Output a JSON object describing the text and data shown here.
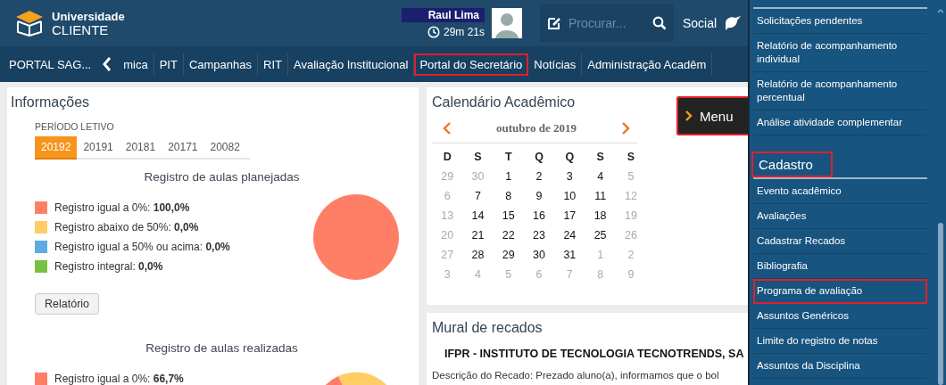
{
  "header": {
    "logo_line1": "Universidade",
    "logo_line2": "CLIENTE",
    "user_name": "Raul Lima",
    "session_timer": "29m 21s",
    "search": {
      "placeholder": "Procurar..."
    },
    "social": "Social"
  },
  "nav": {
    "home": "PORTAL SAG...",
    "items": [
      {
        "label": "mica",
        "highlighted": false
      },
      {
        "label": "PIT",
        "highlighted": false
      },
      {
        "label": "Campanhas",
        "highlighted": false
      },
      {
        "label": "RIT",
        "highlighted": false
      },
      {
        "label": "Avaliação Institucional",
        "highlighted": false
      },
      {
        "label": "Portal do Secretário",
        "highlighted": true
      },
      {
        "label": "Notícias",
        "highlighted": false
      },
      {
        "label": "Administração Acadêm",
        "highlighted": false
      }
    ]
  },
  "info": {
    "title": "Informações",
    "period_label": "PERÍODO LETIVO",
    "periods": [
      {
        "label": "20192",
        "selected": true
      },
      {
        "label": "20191",
        "selected": false
      },
      {
        "label": "20181",
        "selected": false
      },
      {
        "label": "20171",
        "selected": false
      },
      {
        "label": "20082",
        "selected": false
      }
    ],
    "planned": {
      "title": "Registro de aulas planejadas",
      "legend": [
        {
          "label": "Registro igual a 0%:",
          "value": "100,0%",
          "color": "#ff7f66"
        },
        {
          "label": "Registro abaixo de 50%:",
          "value": "0,0%",
          "color": "#ffcc66"
        },
        {
          "label": "Registro igual a 50% ou acima:",
          "value": "0,0%",
          "color": "#5dade2"
        },
        {
          "label": "Registro integral:",
          "value": "0,0%",
          "color": "#7ac143"
        }
      ],
      "chart_data": {
        "type": "pie",
        "series": [
          {
            "values": [
              100,
              0,
              0,
              0
            ]
          }
        ]
      }
    },
    "report_button": "Relatório",
    "done": {
      "title": "Registro de aulas realizadas",
      "legend": [
        {
          "label": "Registro igual a 0%:",
          "value": "66,7%",
          "color": "#ff7f66"
        }
      ]
    }
  },
  "calendar": {
    "title": "Calendário Acadêmico",
    "month": "outubro de 2019",
    "weekdays": [
      "D",
      "S",
      "T",
      "Q",
      "Q",
      "S",
      "S"
    ],
    "weeks": [
      [
        {
          "day": "29",
          "muted": true
        },
        {
          "day": "30",
          "muted": true
        },
        {
          "day": "1",
          "muted": false
        },
        {
          "day": "2",
          "muted": false
        },
        {
          "day": "3",
          "muted": false
        },
        {
          "day": "4",
          "muted": false
        },
        {
          "day": "5",
          "muted": true
        }
      ],
      [
        {
          "day": "6",
          "muted": true
        },
        {
          "day": "7",
          "muted": false
        },
        {
          "day": "8",
          "muted": false
        },
        {
          "day": "9",
          "muted": false
        },
        {
          "day": "10",
          "muted": false
        },
        {
          "day": "11",
          "muted": false
        },
        {
          "day": "12",
          "muted": true
        }
      ],
      [
        {
          "day": "13",
          "muted": true
        },
        {
          "day": "14",
          "muted": false
        },
        {
          "day": "15",
          "muted": false
        },
        {
          "day": "16",
          "muted": false
        },
        {
          "day": "17",
          "muted": false
        },
        {
          "day": "18",
          "muted": false
        },
        {
          "day": "19",
          "muted": true
        }
      ],
      [
        {
          "day": "20",
          "muted": true
        },
        {
          "day": "21",
          "muted": false
        },
        {
          "day": "22",
          "muted": false
        },
        {
          "day": "23",
          "muted": false
        },
        {
          "day": "24",
          "muted": false
        },
        {
          "day": "25",
          "muted": false
        },
        {
          "day": "26",
          "muted": true
        }
      ],
      [
        {
          "day": "27",
          "muted": true
        },
        {
          "day": "28",
          "muted": false
        },
        {
          "day": "29",
          "muted": false
        },
        {
          "day": "30",
          "muted": false
        },
        {
          "day": "31",
          "muted": false
        },
        {
          "day": "1",
          "muted": true
        },
        {
          "day": "2",
          "muted": true
        }
      ],
      [
        {
          "day": "3",
          "muted": true
        },
        {
          "day": "4",
          "muted": true
        },
        {
          "day": "5",
          "muted": true
        },
        {
          "day": "6",
          "muted": true
        },
        {
          "day": "7",
          "muted": true
        },
        {
          "day": "8",
          "muted": true
        },
        {
          "day": "9",
          "muted": true
        }
      ]
    ]
  },
  "menu_button": {
    "label": "Menu",
    "highlighted": true
  },
  "mural": {
    "title": "Mural de recados",
    "heading": "IFPR - INSTITUTO DE TECNOLOGIA TECNOTRENDS, SA",
    "description": "Descrição do Recado: Prezado aluno(a), informamos que o bol"
  },
  "sidebar": {
    "sections": [
      {
        "items": [
          {
            "label": "Solicitações pendentes",
            "highlighted": false
          },
          {
            "label": "Relatório de acompanhamento individual",
            "highlighted": false
          },
          {
            "label": "Relatório de acompanhamento percentual",
            "highlighted": false
          },
          {
            "label": "Análise atividade complementar",
            "highlighted": false
          }
        ]
      },
      {
        "heading": "Cadastro",
        "highlighted": true,
        "items": [
          {
            "label": "Evento acadêmico",
            "highlighted": false
          },
          {
            "label": "Avaliações",
            "highlighted": false
          },
          {
            "label": "Cadastrar Recados",
            "highlighted": false
          },
          {
            "label": "Bibliografia",
            "highlighted": false
          },
          {
            "label": "Programa de avaliação",
            "highlighted": true
          },
          {
            "label": "Assuntos Genéricos",
            "highlighted": false
          },
          {
            "label": "Limite do registro de notas",
            "highlighted": false
          },
          {
            "label": "Assuntos da Disciplina",
            "highlighted": false
          }
        ]
      }
    ]
  }
}
